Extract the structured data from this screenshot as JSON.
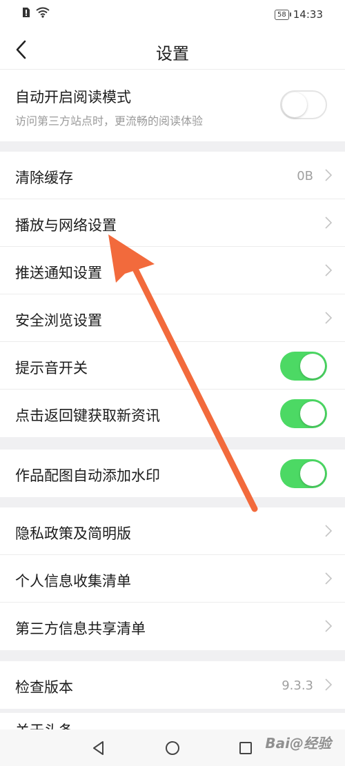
{
  "status_bar": {
    "battery": "58",
    "time": "14:33"
  },
  "header": {
    "title": "设置"
  },
  "reading_mode": {
    "label": "自动开启阅读模式",
    "description": "访问第三方站点时，更流畅的阅读体验",
    "enabled": false
  },
  "group1": {
    "clear_cache": {
      "label": "清除缓存",
      "value": "0B"
    },
    "playback_network": {
      "label": "播放与网络设置"
    },
    "push_notifications": {
      "label": "推送通知设置"
    },
    "safe_browsing": {
      "label": "安全浏览设置"
    },
    "sound_switch": {
      "label": "提示音开关",
      "enabled": true
    },
    "back_refresh": {
      "label": "点击返回键获取新资讯",
      "enabled": true
    }
  },
  "group2": {
    "watermark": {
      "label": "作品配图自动添加水印",
      "enabled": true
    }
  },
  "group3": {
    "privacy_policy": {
      "label": "隐私政策及简明版"
    },
    "personal_info": {
      "label": "个人信息收集清单"
    },
    "third_party_info": {
      "label": "第三方信息共享清单"
    }
  },
  "group4": {
    "check_version": {
      "label": "检查版本",
      "value": "9.3.3"
    },
    "about": {
      "label": "关于头条"
    }
  },
  "watermark_text": "Bai@经验",
  "colors": {
    "toggle_on": "#4cd964",
    "annotation_arrow": "#f26a3c"
  }
}
